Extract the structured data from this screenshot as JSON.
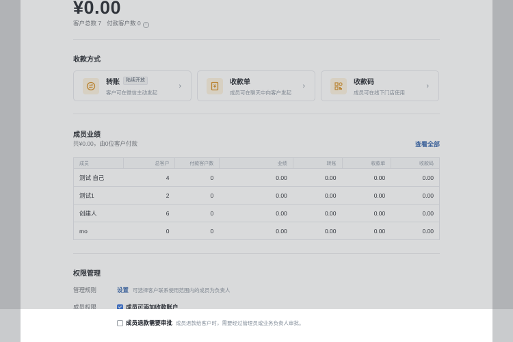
{
  "summary": {
    "amount": "¥0.00",
    "total_customers": "客户总数 7",
    "paid_customers": "付款客户数 0"
  },
  "payment_section": {
    "title": "收款方式",
    "methods": [
      {
        "name": "转账",
        "badge": "陆续开放",
        "desc": "客户可在微信主动发起",
        "icon": "transfer-icon"
      },
      {
        "name": "收款单",
        "badge": "",
        "desc": "成员可在聊天中向客户发起",
        "icon": "receipt-icon"
      },
      {
        "name": "收款码",
        "badge": "",
        "desc": "成员可在线下门店使用",
        "icon": "qrcode-icon"
      }
    ]
  },
  "performance": {
    "title": "成员业绩",
    "subtitle": "共¥0.00，由0位客户付款",
    "view_all": "查看全部",
    "columns": [
      "成员",
      "总客户",
      "付款客户数",
      "业绩",
      "转账",
      "收款单",
      "收款码"
    ],
    "rows": [
      [
        "测试 自己",
        "4",
        "0",
        "0.00",
        "0.00",
        "0.00",
        "0.00"
      ],
      [
        "测试1",
        "2",
        "0",
        "0.00",
        "0.00",
        "0.00",
        "0.00"
      ],
      [
        "创建人",
        "6",
        "0",
        "0.00",
        "0.00",
        "0.00",
        "0.00"
      ],
      [
        "mo",
        "0",
        "0",
        "0.00",
        "0.00",
        "0.00",
        "0.00"
      ]
    ]
  },
  "permissions": {
    "title": "权限管理",
    "rule_label": "管理规则",
    "rule_link": "设置",
    "rule_hint": "可选择客户联系使用范围内的成员为负责人",
    "member_label": "成员权限",
    "option_add_account": "成员可添加收款账户",
    "option_refund_review": "成员退款需要审批",
    "refund_hint": "成员退款给客户时，需要经过管理员或业务负责人审批。"
  },
  "colors": {
    "accent": "#2f5fa8",
    "checkbox": "#2f6bd6",
    "icon_bg": "#fdf2dd",
    "icon_fg": "#d48a1c"
  }
}
